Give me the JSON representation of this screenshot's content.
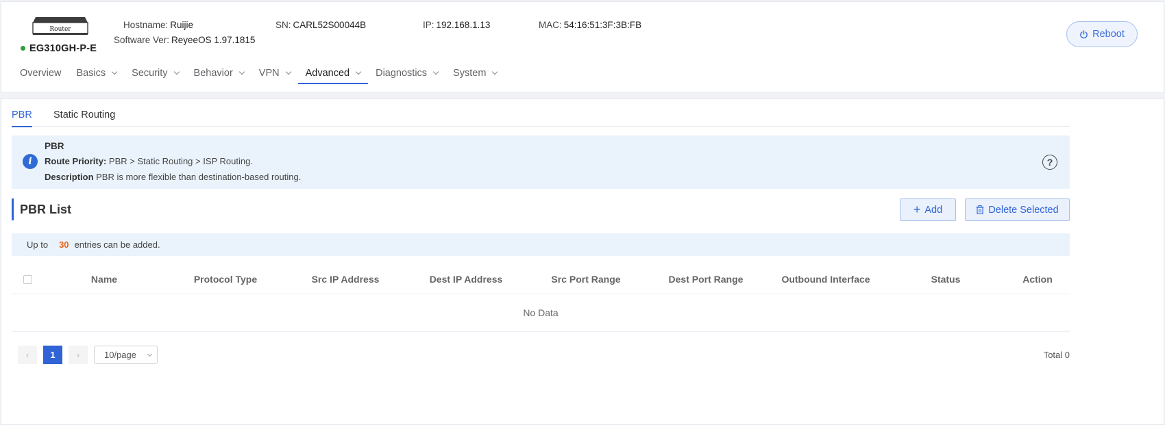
{
  "device": {
    "image_label": "Router",
    "model": "EG310GH-P-E",
    "status_color": "#2e9e3a",
    "hostname_label": "Hostname:",
    "hostname": "Ruijie",
    "software_label": "Software Ver:",
    "software": "ReyeeOS 1.97.1815",
    "sn_label": "SN:",
    "sn": "CARL52S00044B",
    "ip_label": "IP:",
    "ip": "192.168.1.13",
    "mac_label": "MAC:",
    "mac": "54:16:51:3F:3B:FB"
  },
  "reboot_label": "Reboot",
  "nav": [
    {
      "label": "Overview",
      "dropdown": false
    },
    {
      "label": "Basics",
      "dropdown": true
    },
    {
      "label": "Security",
      "dropdown": true
    },
    {
      "label": "Behavior",
      "dropdown": true
    },
    {
      "label": "VPN",
      "dropdown": true
    },
    {
      "label": "Advanced",
      "dropdown": true,
      "active": true
    },
    {
      "label": "Diagnostics",
      "dropdown": true
    },
    {
      "label": "System",
      "dropdown": true
    }
  ],
  "tabs": {
    "pbr": "PBR",
    "static_routing": "Static Routing"
  },
  "notice": {
    "title": "PBR",
    "priority_label": "Route Priority:",
    "priority_text": "PBR > Static Routing > ISP Routing.",
    "description_label": "Description",
    "description_text": "PBR is more flexible than destination-based routing."
  },
  "list": {
    "title": "PBR List",
    "add_label": "Add",
    "delete_label": "Delete Selected",
    "limit_prefix": "Up to",
    "limit_num": "30",
    "limit_suffix": "entries can be added."
  },
  "table": {
    "columns": [
      "Name",
      "Protocol Type",
      "Src IP Address",
      "Dest IP Address",
      "Src Port Range",
      "Dest Port Range",
      "Outbound Interface",
      "Status",
      "Action"
    ],
    "empty_text": "No Data"
  },
  "pagination": {
    "prev": "‹",
    "current_page": "1",
    "next": "›",
    "page_size": "10/page",
    "total": "Total 0"
  },
  "colors": {
    "accent": "#2f63d6",
    "limit_number": "#e8661c",
    "notice_bg": "#eaf3fc"
  }
}
